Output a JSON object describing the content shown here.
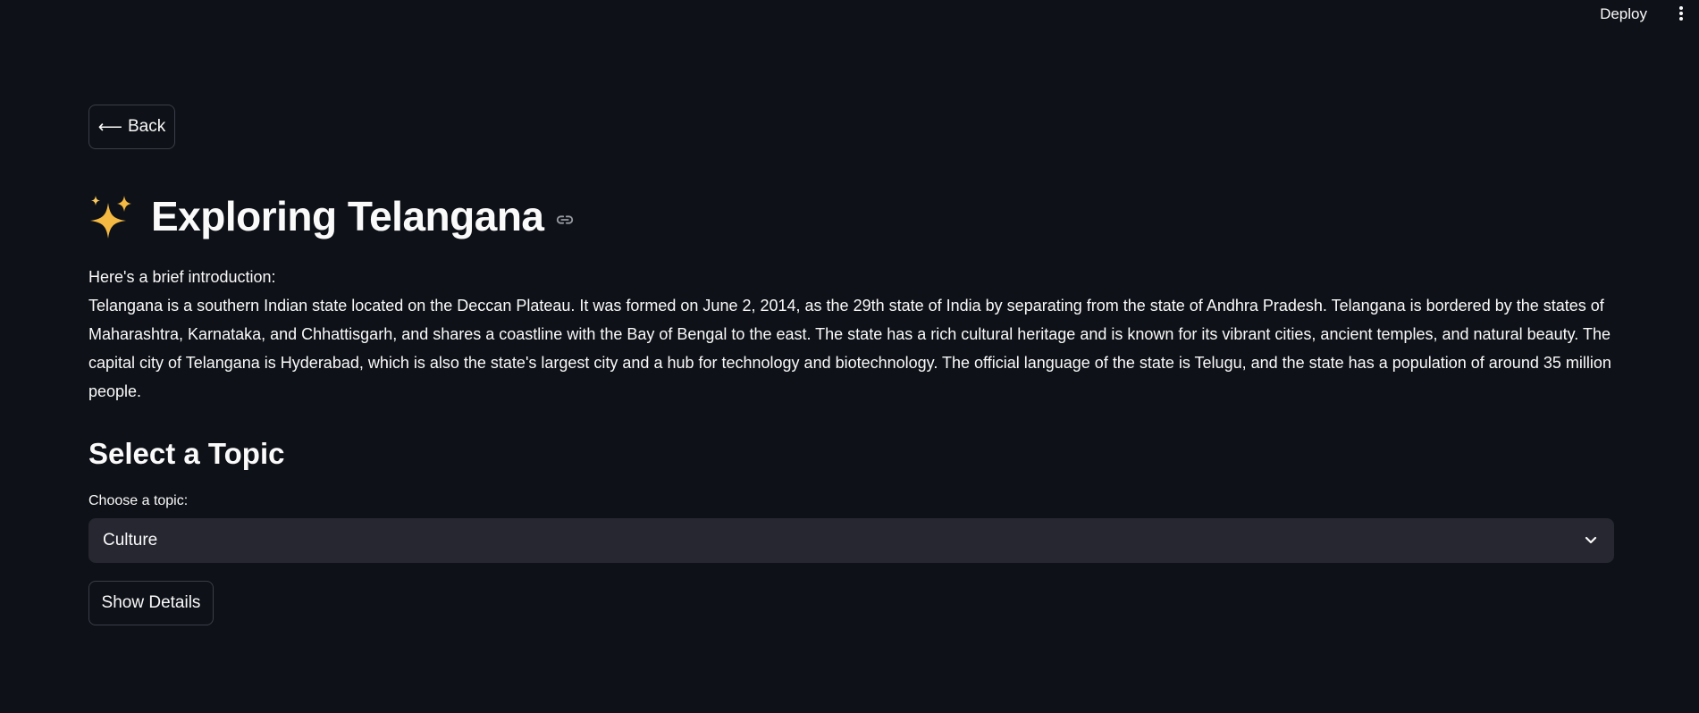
{
  "header": {
    "deploy_label": "Deploy",
    "menu_icon": "kebab-menu-icon"
  },
  "back_button": {
    "label": "Back",
    "icon": "left-arrow-icon"
  },
  "title": {
    "emoji": "sparkles-icon",
    "text": "Exploring Telangana",
    "anchor_icon": "link-icon"
  },
  "intro": {
    "label": "Here's a brief introduction:",
    "text": "Telangana is a southern Indian state located on the Deccan Plateau. It was formed on June 2, 2014, as the 29th state of India by separating from the state of Andhra Pradesh. Telangana is bordered by the states of Maharashtra, Karnataka, and Chhattisgarh, and shares a coastline with the Bay of Bengal to the east. The state has a rich cultural heritage and is known for its vibrant cities, ancient temples, and natural beauty. The capital city of Telangana is Hyderabad, which is also the state's largest city and a hub for technology and biotechnology. The official language of the state is Telugu, and the state has a population of around 35 million people."
  },
  "topic_section": {
    "heading": "Select a Topic",
    "select_label": "Choose a topic:",
    "selected_value": "Culture",
    "show_button_label": "Show Details"
  },
  "colors": {
    "background": "#0e1117",
    "text": "#fafafa",
    "select_bg": "#262730",
    "button_border": "#3b3e48"
  }
}
